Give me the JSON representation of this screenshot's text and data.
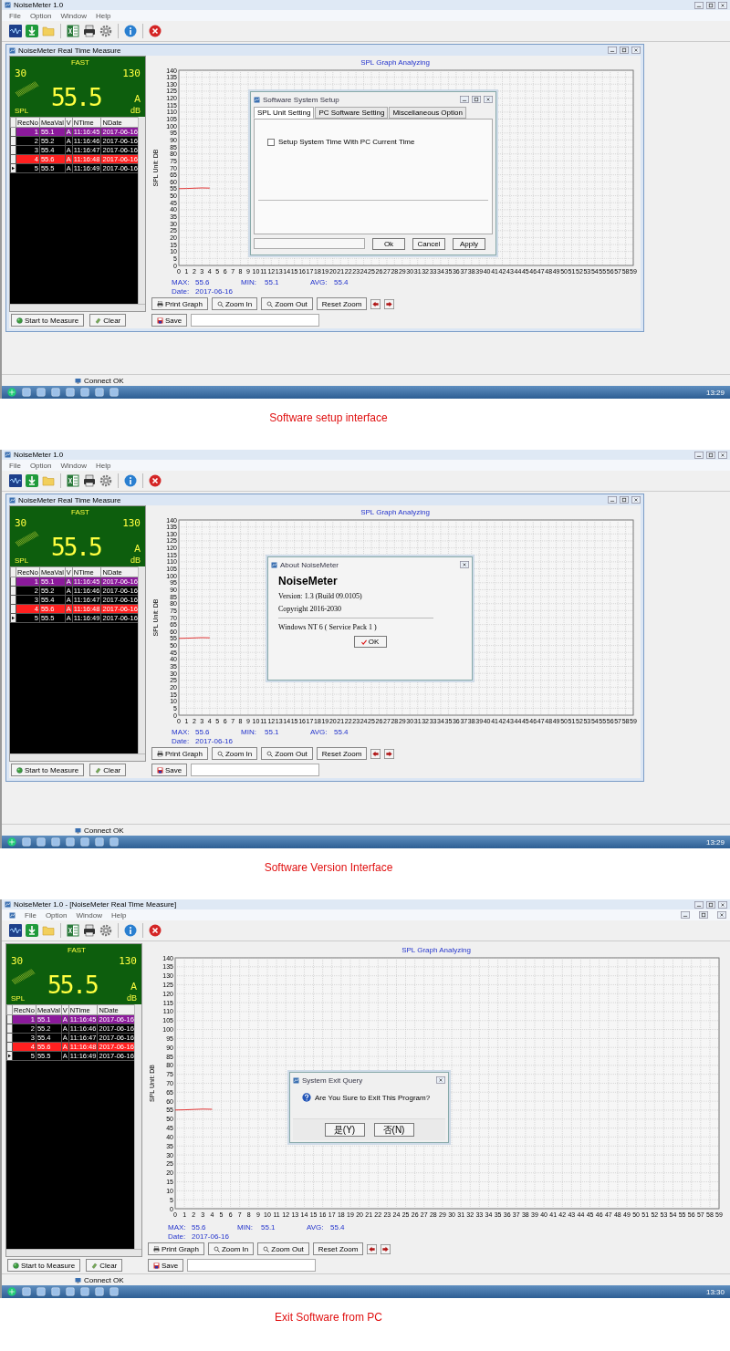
{
  "screens": [
    {
      "app_title": "NoiseMeter 1.0",
      "menu": [
        "File",
        "Option",
        "Window",
        "Help"
      ],
      "measure_window": {
        "title": "NoiseMeter Real Time Measure",
        "maximized": false
      },
      "lcd": {
        "mode": "FAST",
        "range_low": "30",
        "range_high": "130",
        "reading": "55.5",
        "weighting": "A",
        "unit": "dB",
        "label": "SPL"
      },
      "table": {
        "columns": [
          "RecNo",
          "MeaVal",
          "V",
          "NTime",
          "NDate"
        ],
        "rows": [
          {
            "cells": [
              "1",
              "55.1",
              "A",
              "11:16:45",
              "2017-06-16"
            ],
            "color": "#8b1a9b",
            "current": false
          },
          {
            "cells": [
              "2",
              "55.2",
              "A",
              "11:16:46",
              "2017-06-16"
            ],
            "color": "#000000",
            "current": false
          },
          {
            "cells": [
              "3",
              "55.4",
              "A",
              "11:16:47",
              "2017-06-16"
            ],
            "color": "#000000",
            "current": false
          },
          {
            "cells": [
              "4",
              "55.6",
              "A",
              "11:16:48",
              "2017-06-16"
            ],
            "color": "#ff2020",
            "current": false
          },
          {
            "cells": [
              "5",
              "55.5",
              "A",
              "11:16:49",
              "2017-06-16"
            ],
            "color": "#000000",
            "current": true
          }
        ]
      },
      "chart_data": {
        "type": "line",
        "title": "SPL Graph Analyzing",
        "ylabel": "SPL Unit: DB",
        "x": [
          0,
          1,
          2,
          3,
          4
        ],
        "series": [
          {
            "color": "#e02020",
            "values": [
              55.1,
              55.2,
              55.4,
              55.6,
              55.5
            ]
          }
        ],
        "xlim": [
          0,
          59
        ],
        "ylim": [
          0,
          140
        ],
        "grid": true,
        "xticks": [
          0,
          1,
          2,
          3,
          4,
          5,
          6,
          7,
          8,
          9,
          10,
          11,
          12,
          13,
          14,
          15,
          16,
          17,
          18,
          19,
          20,
          21,
          22,
          23,
          24,
          25,
          26,
          27,
          28,
          29,
          30,
          31,
          32,
          33,
          34,
          35,
          36,
          37,
          38,
          39,
          40,
          41,
          42,
          43,
          44,
          45,
          46,
          47,
          48,
          49,
          50,
          51,
          52,
          53,
          54,
          55,
          56,
          57,
          58,
          59
        ],
        "yticks": [
          0,
          5,
          10,
          15,
          20,
          25,
          30,
          35,
          40,
          45,
          50,
          55,
          60,
          65,
          70,
          75,
          80,
          85,
          90,
          95,
          100,
          105,
          110,
          115,
          120,
          125,
          130,
          135,
          140
        ]
      },
      "stats": [
        {
          "label": "MAX:",
          "value": "55.6"
        },
        {
          "label": "MIN:",
          "value": "55.1"
        },
        {
          "label": "AVG:",
          "value": "55.4"
        }
      ],
      "date": {
        "label": "Date:",
        "value": "2017-06-16"
      },
      "graph_buttons": [
        {
          "label": "Print Graph",
          "kind": "print"
        },
        {
          "label": "Zoom In",
          "kind": "zoom-in"
        },
        {
          "label": "Zoom Out",
          "kind": "zoom-out"
        },
        {
          "label": "Reset Zoom",
          "kind": "reset"
        }
      ],
      "bottom_buttons": [
        {
          "label": "Start to Measure",
          "kind": "start"
        },
        {
          "label": "Clear",
          "kind": "clear"
        },
        {
          "label": "Save",
          "kind": "save"
        }
      ],
      "status": "Connect OK",
      "clock": "13:29",
      "dialog": {
        "kind": "setup",
        "title": "Software System Setup",
        "tabs": [
          {
            "label": "SPL Unit Setting",
            "selected": true
          },
          {
            "label": "PC Software Setting",
            "selected": false
          },
          {
            "label": "Miscellaneous Option",
            "selected": false
          }
        ],
        "checkbox": {
          "label": "Setup System Time With PC Current Time",
          "checked": false
        },
        "buttons": [
          "Ok",
          "Cancel",
          "Apply"
        ]
      },
      "caption": "Software setup interface"
    },
    {
      "app_title": "NoiseMeter 1.0",
      "menu": [
        "File",
        "Option",
        "Window",
        "Help"
      ],
      "measure_window": {
        "title": "NoiseMeter Real Time Measure",
        "maximized": false
      },
      "lcd": {
        "mode": "FAST",
        "range_low": "30",
        "range_high": "130",
        "reading": "55.5",
        "weighting": "A",
        "unit": "dB",
        "label": "SPL"
      },
      "table": {
        "columns": [
          "RecNo",
          "MeaVal",
          "V",
          "NTime",
          "NDate"
        ],
        "rows": [
          {
            "cells": [
              "1",
              "55.1",
              "A",
              "11:16:45",
              "2017-06-16"
            ],
            "color": "#8b1a9b",
            "current": false
          },
          {
            "cells": [
              "2",
              "55.2",
              "A",
              "11:16:46",
              "2017-06-16"
            ],
            "color": "#000000",
            "current": false
          },
          {
            "cells": [
              "3",
              "55.4",
              "A",
              "11:16:47",
              "2017-06-16"
            ],
            "color": "#000000",
            "current": false
          },
          {
            "cells": [
              "4",
              "55.6",
              "A",
              "11:16:48",
              "2017-06-16"
            ],
            "color": "#ff2020",
            "current": false
          },
          {
            "cells": [
              "5",
              "55.5",
              "A",
              "11:16:49",
              "2017-06-16"
            ],
            "color": "#000000",
            "current": true
          }
        ]
      },
      "chart_data": {
        "type": "line",
        "title": "SPL Graph Analyzing",
        "ylabel": "SPL Unit: DB",
        "x": [
          0,
          1,
          2,
          3,
          4
        ],
        "series": [
          {
            "color": "#e02020",
            "values": [
              55.1,
              55.2,
              55.4,
              55.6,
              55.5
            ]
          }
        ],
        "xlim": [
          0,
          59
        ],
        "ylim": [
          0,
          140
        ],
        "grid": true,
        "xticks": [
          0,
          1,
          2,
          3,
          4,
          5,
          6,
          7,
          8,
          9,
          10,
          11,
          12,
          13,
          14,
          15,
          16,
          17,
          18,
          19,
          20,
          21,
          22,
          23,
          24,
          25,
          26,
          27,
          28,
          29,
          30,
          31,
          32,
          33,
          34,
          35,
          36,
          37,
          38,
          39,
          40,
          41,
          42,
          43,
          44,
          45,
          46,
          47,
          48,
          49,
          50,
          51,
          52,
          53,
          54,
          55,
          56,
          57,
          58,
          59
        ],
        "yticks": [
          0,
          5,
          10,
          15,
          20,
          25,
          30,
          35,
          40,
          45,
          50,
          55,
          60,
          65,
          70,
          75,
          80,
          85,
          90,
          95,
          100,
          105,
          110,
          115,
          120,
          125,
          130,
          135,
          140
        ]
      },
      "stats": [
        {
          "label": "MAX:",
          "value": "55.6"
        },
        {
          "label": "MIN:",
          "value": "55.1"
        },
        {
          "label": "AVG:",
          "value": "55.4"
        }
      ],
      "date": {
        "label": "Date:",
        "value": "2017-06-16"
      },
      "graph_buttons": [
        {
          "label": "Print Graph",
          "kind": "print"
        },
        {
          "label": "Zoom In",
          "kind": "zoom-in"
        },
        {
          "label": "Zoom Out",
          "kind": "zoom-out"
        },
        {
          "label": "Reset Zoom",
          "kind": "reset"
        }
      ],
      "bottom_buttons": [
        {
          "label": "Start to Measure",
          "kind": "start"
        },
        {
          "label": "Clear",
          "kind": "clear"
        },
        {
          "label": "Save",
          "kind": "save"
        }
      ],
      "status": "Connect OK",
      "clock": "13:29",
      "dialog": {
        "kind": "about",
        "title": "About NoiseMeter",
        "heading": "NoiseMeter",
        "lines": [
          "Version: 1.3 (Build 09.0105)",
          "Copyright 2016-2030"
        ],
        "os_info": "Windows NT 6 ( Service Pack 1 )",
        "buttons": [
          "OK"
        ]
      },
      "caption": "Software Version Interface"
    },
    {
      "app_title": "NoiseMeter 1.0 - [NoiseMeter Real Time Measure]",
      "menu": [
        "File",
        "Option",
        "Window",
        "Help"
      ],
      "measure_window": {
        "maximized": true
      },
      "lcd": {
        "mode": "FAST",
        "range_low": "30",
        "range_high": "130",
        "reading": "55.5",
        "weighting": "A",
        "unit": "dB",
        "label": "SPL"
      },
      "table": {
        "columns": [
          "RecNo",
          "MeaVal",
          "V",
          "NTime",
          "NDate"
        ],
        "rows": [
          {
            "cells": [
              "1",
              "55.1",
              "A",
              "11:16:45",
              "2017-06-16"
            ],
            "color": "#8b1a9b",
            "current": false
          },
          {
            "cells": [
              "2",
              "55.2",
              "A",
              "11:16:46",
              "2017-06-16"
            ],
            "color": "#000000",
            "current": false
          },
          {
            "cells": [
              "3",
              "55.4",
              "A",
              "11:16:47",
              "2017-06-16"
            ],
            "color": "#000000",
            "current": false
          },
          {
            "cells": [
              "4",
              "55.6",
              "A",
              "11:16:48",
              "2017-06-16"
            ],
            "color": "#ff2020",
            "current": false
          },
          {
            "cells": [
              "5",
              "55.5",
              "A",
              "11:16:49",
              "2017-06-16"
            ],
            "color": "#000000",
            "current": true
          }
        ]
      },
      "chart_data": {
        "type": "line",
        "title": "SPL Graph Analyzing",
        "ylabel": "SPL Unit: DB",
        "x": [
          0,
          1,
          2,
          3,
          4
        ],
        "series": [
          {
            "color": "#e02020",
            "values": [
              55.1,
              55.2,
              55.4,
              55.6,
              55.5
            ]
          }
        ],
        "xlim": [
          0,
          59
        ],
        "ylim": [
          0,
          140
        ],
        "grid": true,
        "xticks": [
          0,
          1,
          2,
          3,
          4,
          5,
          6,
          7,
          8,
          9,
          10,
          11,
          12,
          13,
          14,
          15,
          16,
          17,
          18,
          19,
          20,
          21,
          22,
          23,
          24,
          25,
          26,
          27,
          28,
          29,
          30,
          31,
          32,
          33,
          34,
          35,
          36,
          37,
          38,
          39,
          40,
          41,
          42,
          43,
          44,
          45,
          46,
          47,
          48,
          49,
          50,
          51,
          52,
          53,
          54,
          55,
          56,
          57,
          58,
          59
        ],
        "yticks": [
          0,
          5,
          10,
          15,
          20,
          25,
          30,
          35,
          40,
          45,
          50,
          55,
          60,
          65,
          70,
          75,
          80,
          85,
          90,
          95,
          100,
          105,
          110,
          115,
          120,
          125,
          130,
          135,
          140
        ]
      },
      "stats": [
        {
          "label": "MAX:",
          "value": "55.6"
        },
        {
          "label": "MIN:",
          "value": "55.1"
        },
        {
          "label": "AVG:",
          "value": "55.4"
        }
      ],
      "date": {
        "label": "Date:",
        "value": "2017-06-16"
      },
      "graph_buttons": [
        {
          "label": "Print Graph",
          "kind": "print"
        },
        {
          "label": "Zoom In",
          "kind": "zoom-in"
        },
        {
          "label": "Zoom Out",
          "kind": "zoom-out"
        },
        {
          "label": "Reset Zoom",
          "kind": "reset"
        }
      ],
      "bottom_buttons": [
        {
          "label": "Start to Measure",
          "kind": "start"
        },
        {
          "label": "Clear",
          "kind": "clear"
        },
        {
          "label": "Save",
          "kind": "save"
        }
      ],
      "status": "Connect OK",
      "clock": "13:30",
      "dialog": {
        "kind": "exit",
        "title": "System Exit Query",
        "message": "Are You Sure to Exit This Program?",
        "buttons": [
          "是(Y)",
          "否(N)"
        ]
      },
      "caption": "Exit Software from PC"
    }
  ]
}
